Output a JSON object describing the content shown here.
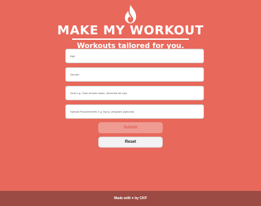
{
  "header": {
    "logo_icon": "flame-icon",
    "title": "MAKE MY WORKOUT",
    "tagline": "Workouts tailored for you."
  },
  "form": {
    "age_placeholder": "Age",
    "gender_placeholder": "Gender",
    "goal_placeholder": "Goal e.g. Gain muscle mass, decrease fat loss",
    "requests_placeholder": "Special Requirements e.g. Injury, pregnant (optional)",
    "submit_label": "Submit",
    "reset_label": "Reset"
  },
  "footer": {
    "text_before": "Made with",
    "heart_icon": "heart-icon",
    "heart": "♥",
    "text_after": "by CKP"
  },
  "colors": {
    "background": "#e8685b",
    "footer": "#9c4b44",
    "submit_button": "#ef9b92",
    "reset_button": "#f2f2f2"
  }
}
